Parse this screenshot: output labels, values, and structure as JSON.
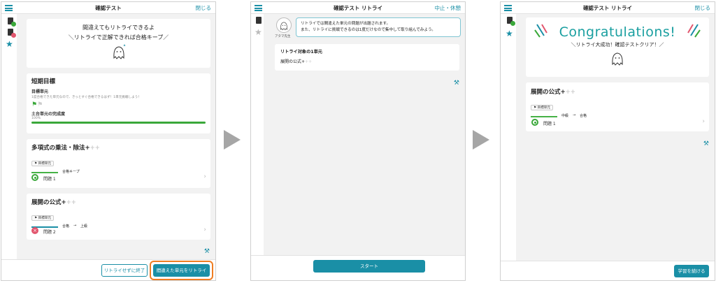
{
  "colors": {
    "accent": "#1a8fa6",
    "green": "#3aa83a",
    "red": "#e2566e",
    "highlight": "#ef7d22"
  },
  "screen1": {
    "title": "確認テスト",
    "close": "閉じる",
    "banner": {
      "line1": "間違えてもリトライできるよ",
      "line2": "＼リトライで正解できれば合格キープ／"
    },
    "goal": {
      "heading": "短期目標",
      "unit_label": "目標単元",
      "unit_desc": "1度合格できた単元なので、きっとすぐ合格できるはず！1単元挑戦しよう！",
      "completion_label": "土台単元の完成度",
      "completion_value": "100%",
      "completion_fraction": 1.0
    },
    "unit1": {
      "title": "多項式の乗法・除法",
      "plus": "+",
      "plus_dim": "++",
      "tag": "目標単元",
      "status": "合格キープ",
      "question": "問題 1",
      "result": "correct"
    },
    "unit2": {
      "title": "展開の公式",
      "plus": "+",
      "plus_dim": "++",
      "tag": "目標単元",
      "from": "合格",
      "to": "上級",
      "question": "問題 2",
      "result": "wrong"
    },
    "btn_end": "リトライせずに終了",
    "btn_retry": "間違えた単元をリトライ"
  },
  "screen2": {
    "title": "確認テスト リトライ",
    "pause": "中止・休憩",
    "speaker": "アタマ先生",
    "msg1": "リトライでは間違えた単元の問題が出題されます。",
    "msg2": "また、リトライに挑戦できるのは1度だけなので集中して取り組んでみよう。",
    "target_heading": "リトライ対象の1単元",
    "target_unit": "展開の公式",
    "plus": "+",
    "plus_dim": "++",
    "start": "スタート"
  },
  "screen3": {
    "title": "確認テスト リトライ",
    "close": "閉じる",
    "congrats": "Congratulations!",
    "sub": "＼リトライ大成功！確認テストクリア！／",
    "unit": {
      "title": "展開の公式",
      "plus": "+",
      "plus_dim": "++",
      "tag": "目標単元",
      "from": "中級",
      "to": "合格",
      "question": "問題 1",
      "result": "correct"
    },
    "continue": "学習を続ける"
  },
  "icons": {
    "menu": "hamburger-icon",
    "doc": "document-icon",
    "star": "star-icon",
    "tool": "tools-icon",
    "arrow": "next-arrow-icon"
  }
}
